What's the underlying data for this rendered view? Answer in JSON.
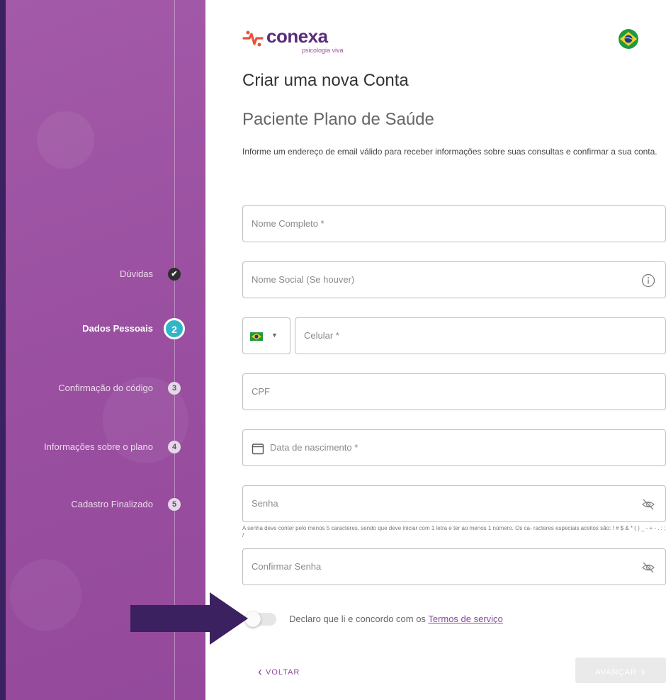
{
  "brand": {
    "name": "conexa",
    "tagline": "psicologia viva"
  },
  "steps": [
    {
      "label": "Dúvidas",
      "marker": "✔",
      "state": "done"
    },
    {
      "label": "Dados Pessoais",
      "marker": "2",
      "state": "current"
    },
    {
      "label": "Confirmação do código",
      "marker": "3",
      "state": "pending"
    },
    {
      "label": "Informações sobre o plano",
      "marker": "4",
      "state": "pending"
    },
    {
      "label": "Cadastro Finalizado",
      "marker": "5",
      "state": "pending"
    }
  ],
  "form": {
    "title": "Criar uma nova Conta",
    "subtitle": "Paciente Plano de Saúde",
    "info": "Informe um endereço de email válido para receber informações sobre suas consultas e confirmar a sua conta.",
    "full_name_placeholder": "Nome Completo *",
    "social_name_placeholder": "Nome Social (Se houver)",
    "phone_placeholder": "Celular *",
    "cpf_placeholder": "CPF",
    "birth_placeholder": "Data de nascimento *",
    "password_placeholder": "Senha",
    "password_hint": "A senha deve conter pelo menos 5 caracteres, sendo que deve iniciar com 1 letra e ter ao menos 1 número. Os ca- racteres especiais aceitos são: ! # $ & * ( ) _ - + - . : ; /",
    "confirm_password_placeholder": "Confirmar Senha",
    "terms_text": "Declaro que li e concordo com os ",
    "terms_link": "Termos de serviço",
    "terms_accepted": false
  },
  "actions": {
    "back_label": "VOLTAR",
    "next_label": "AVANÇAR"
  },
  "colors": {
    "sidebar": "#9a4fa0",
    "accent": "#2fb6c9",
    "brand_purple": "#5a2d7a",
    "background": "#3b2160"
  }
}
